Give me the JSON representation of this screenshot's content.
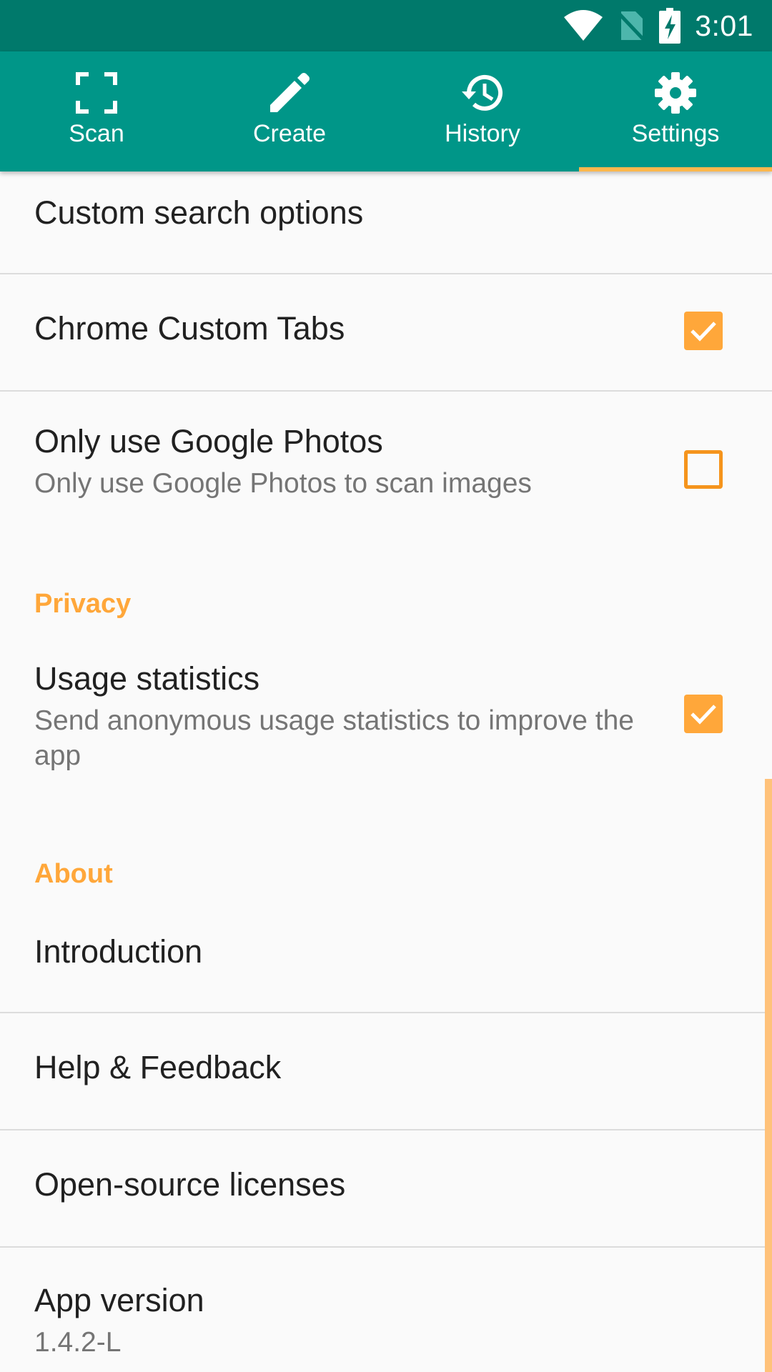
{
  "status_bar": {
    "time": "3:01"
  },
  "tabs": [
    {
      "label": "Scan",
      "icon": "scan-frame-icon",
      "active": false
    },
    {
      "label": "Create",
      "icon": "pencil-icon",
      "active": false
    },
    {
      "label": "History",
      "icon": "history-icon",
      "active": false
    },
    {
      "label": "Settings",
      "icon": "gear-icon",
      "active": true
    }
  ],
  "settings": {
    "custom_search": {
      "title": "Custom search options"
    },
    "chrome_tabs": {
      "title": "Chrome Custom Tabs",
      "checked": true
    },
    "google_photos": {
      "title": "Only use Google Photos",
      "summary": "Only use Google Photos to scan images",
      "checked": false
    },
    "privacy_header": "Privacy",
    "usage_stats": {
      "title": "Usage statistics",
      "summary": "Send anonymous usage statistics to improve the app",
      "checked": true
    },
    "about_header": "About",
    "introduction": {
      "title": "Introduction"
    },
    "help": {
      "title": "Help & Feedback"
    },
    "licenses": {
      "title": "Open-source licenses"
    },
    "app_version": {
      "title": "App version",
      "value": "1.4.2-L"
    }
  },
  "colors": {
    "primary": "#009688",
    "primary_dark": "#00796b",
    "accent": "#ffa73a",
    "indicator": "#ffb74d"
  }
}
